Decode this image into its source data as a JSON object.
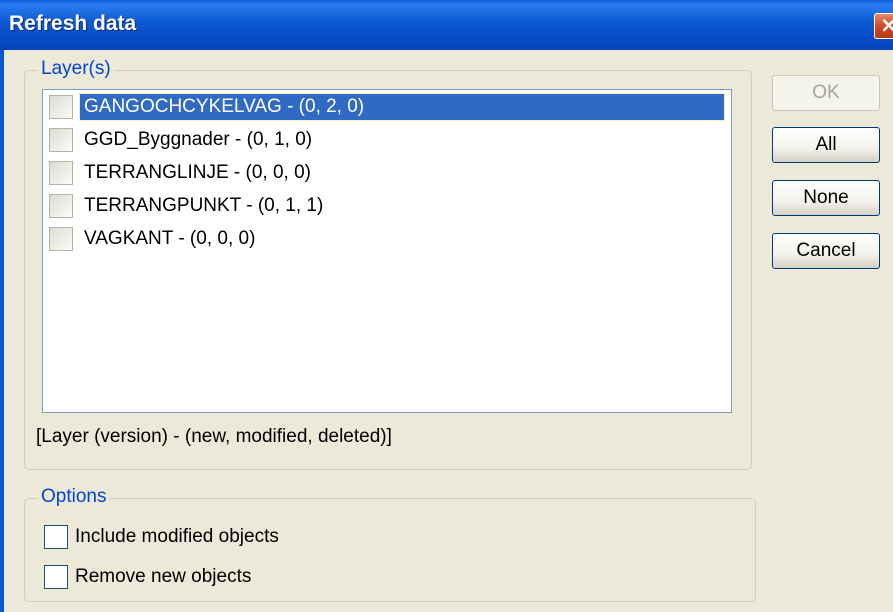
{
  "window": {
    "title": "Refresh data"
  },
  "layers_group": {
    "legend": "Layer(s)",
    "items": [
      {
        "label": "GANGOCHCYKELVAG - (0, 2, 0)",
        "checked": false,
        "selected": true
      },
      {
        "label": "GGD_Byggnader - (0, 1, 0)",
        "checked": false,
        "selected": false
      },
      {
        "label": "TERRANGLINJE - (0, 0, 0)",
        "checked": false,
        "selected": false
      },
      {
        "label": "TERRANGPUNKT - (0, 1, 1)",
        "checked": false,
        "selected": false
      },
      {
        "label": "VAGKANT - (0, 0, 0)",
        "checked": false,
        "selected": false
      }
    ],
    "hint": "[Layer (version) - (new, modified, deleted)]"
  },
  "options_group": {
    "legend": "Options",
    "include_modified": {
      "label": "Include modified objects",
      "checked": false
    },
    "remove_new": {
      "label": "Remove new objects",
      "checked": false
    }
  },
  "buttons": {
    "ok": {
      "label": "OK",
      "enabled": false
    },
    "all": {
      "label": "All"
    },
    "none": {
      "label": "None"
    },
    "cancel": {
      "label": "Cancel"
    }
  },
  "icons": {
    "close": "close-icon"
  },
  "colors": {
    "titlebar": "#0a58d0",
    "selection": "#316ac5",
    "legend_text": "#0046d5",
    "close_button": "#cc4622"
  }
}
